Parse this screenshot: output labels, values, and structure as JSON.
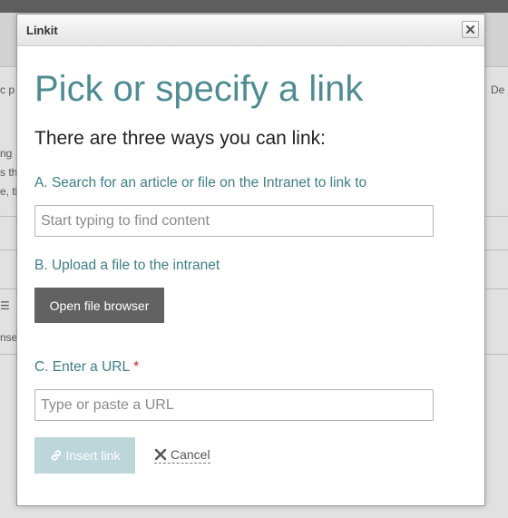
{
  "background": {
    "fragments": [
      {
        "id": "c-p",
        "text": "c p"
      },
      {
        "id": "de",
        "text": "De"
      },
      {
        "id": "ng",
        "text": "ng"
      },
      {
        "id": "s-th",
        "text": "s th"
      },
      {
        "id": "e-th",
        "text": "e, th"
      },
      {
        "id": "nse",
        "text": "nse"
      },
      {
        "id": "menu-glyph",
        "text": "☰"
      }
    ]
  },
  "dialog": {
    "title": "Linkit",
    "close_icon": "close-icon",
    "heading": "Pick or specify a link",
    "subheading": "There are three ways you can link:",
    "search": {
      "label": "A. Search for an article or file on the Intranet to link to",
      "placeholder": "Start typing to find content",
      "value": ""
    },
    "upload": {
      "label": "B. Upload a file to the intranet",
      "button_label": "Open file browser"
    },
    "url": {
      "label": "C. Enter a URL",
      "required_marker": "*",
      "placeholder": "Type or paste a URL",
      "value": ""
    },
    "actions": {
      "insert_label": "Insert link",
      "insert_icon": "link-icon",
      "cancel_label": "Cancel",
      "cancel_icon": "x-icon"
    }
  },
  "colors": {
    "heading": "#4e8c91",
    "label": "#3e7d85",
    "required": "#d01d1d",
    "browse_button": "#626262",
    "insert_button_disabled": "#bcd6da"
  }
}
